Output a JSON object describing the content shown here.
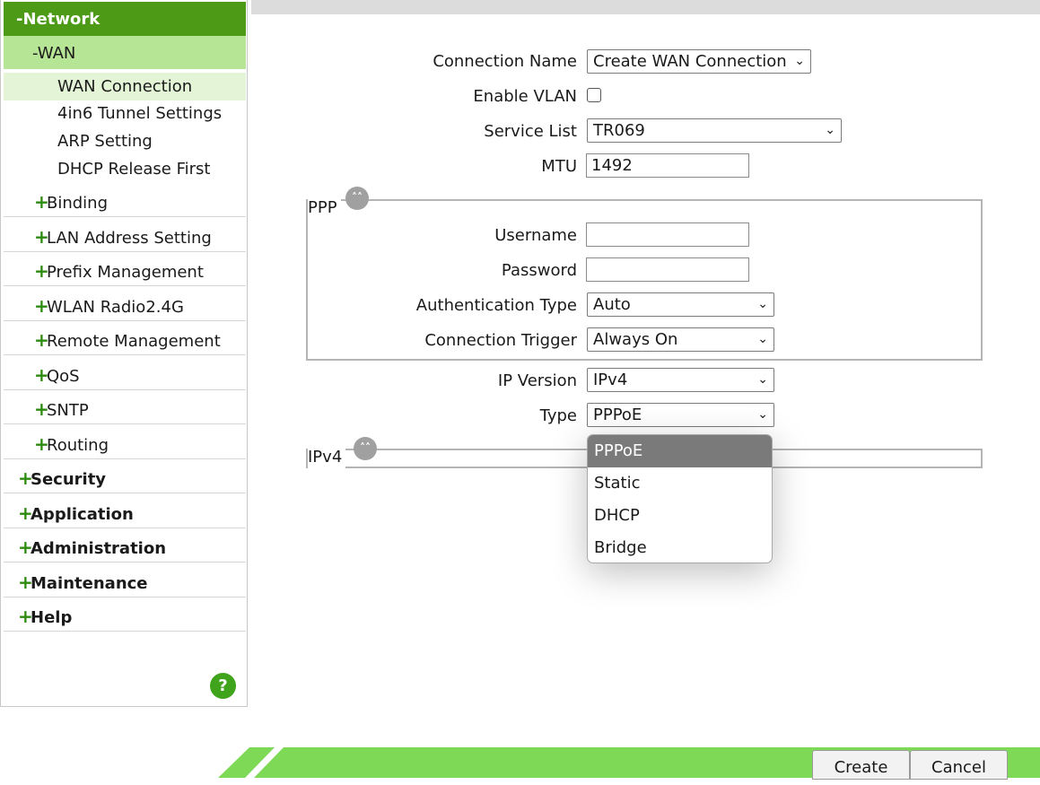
{
  "sidebar": {
    "network": "-Network",
    "wan": "-WAN",
    "wan_subitems": [
      "WAN Connection",
      "4in6 Tunnel Settings",
      "ARP Setting",
      "DHCP Release First"
    ],
    "network_items": [
      "Binding",
      "LAN Address Setting",
      "Prefix Management",
      "WLAN Radio2.4G",
      "Remote Management",
      "QoS",
      "SNTP",
      "Routing"
    ],
    "top_items": [
      "Security",
      "Application",
      "Administration",
      "Maintenance",
      "Help"
    ],
    "plus": "+",
    "help_icon": "?"
  },
  "form": {
    "connection_name_label": "Connection Name",
    "connection_name_value": "Create WAN Connection",
    "enable_vlan_label": "Enable VLAN",
    "service_list_label": "Service List",
    "service_list_value": "TR069",
    "mtu_label": "MTU",
    "mtu_value": "1492",
    "ppp_legend": "PPP",
    "username_label": "Username",
    "username_value": "",
    "password_label": "Password",
    "password_value": "",
    "auth_type_label": "Authentication Type",
    "auth_type_value": "Auto",
    "conn_trigger_label": "Connection Trigger",
    "conn_trigger_value": "Always On",
    "ip_version_label": "IP Version",
    "ip_version_value": "IPv4",
    "type_label": "Type",
    "type_value": "PPPoE",
    "ipv4_legend": "IPv4"
  },
  "type_dropdown": {
    "options": [
      "PPPoE",
      "Static",
      "DHCP",
      "Bridge"
    ],
    "selected_index": 0
  },
  "buttons": {
    "create": "Create",
    "cancel": "Cancel"
  },
  "colors": {
    "nav_header": "#4c9a16",
    "nav_selected": "#b7e596",
    "accent_green": "#7ed957"
  }
}
